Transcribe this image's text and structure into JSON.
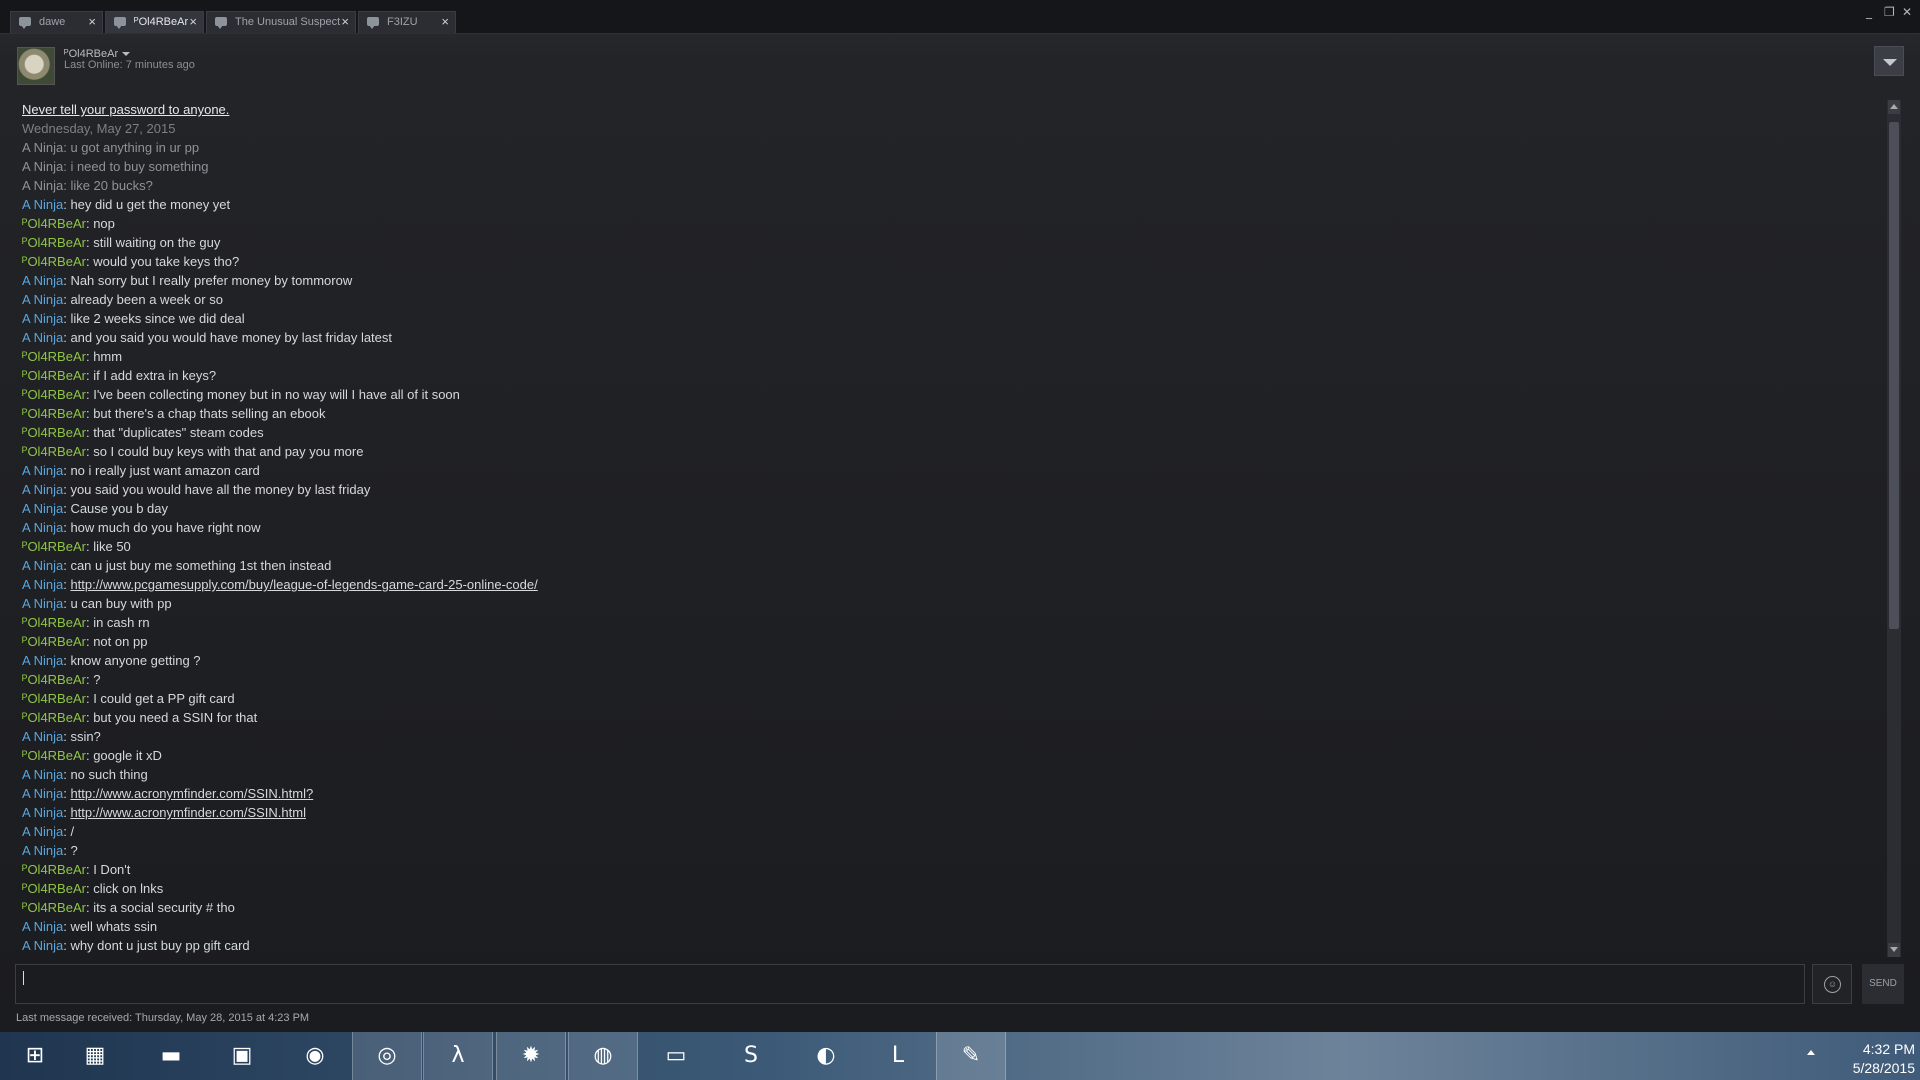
{
  "tabs": [
    {
      "label": "dawe",
      "active": false
    },
    {
      "label": "ᴾOl4RBeAr",
      "active": true
    },
    {
      "label": "The Unusual Suspect",
      "active": false
    },
    {
      "label": "F3IZU",
      "active": false
    }
  ],
  "window_controls": {
    "minimize": "_",
    "restore": "❐",
    "close": "✕"
  },
  "header": {
    "name": "ᴾOl4RBeAr",
    "status": "Last Online: 7 minutes ago"
  },
  "chat": {
    "system_warning": "Never tell your password to anyone.",
    "date": "Wednesday, May 27, 2015",
    "messages": [
      {
        "who": "A Ninja",
        "text": "u got anything in ur pp",
        "old": true
      },
      {
        "who": "A Ninja",
        "text": "i need to buy something",
        "old": true
      },
      {
        "who": "A Ninja",
        "text": "like 20 bucks?",
        "old": true
      },
      {
        "who": "A Ninja",
        "text": "hey did u get the money yet"
      },
      {
        "who": "ᴾOl4RBeAr",
        "text": "nop"
      },
      {
        "who": "ᴾOl4RBeAr",
        "text": "still waiting on the guy"
      },
      {
        "who": "ᴾOl4RBeAr",
        "text": "would you take keys tho?"
      },
      {
        "who": "A Ninja",
        "text": "Nah sorry but I really prefer money by tommorow"
      },
      {
        "who": "A Ninja",
        "text": "already been a week or so"
      },
      {
        "who": "A Ninja",
        "text": "like 2 weeks since we did deal"
      },
      {
        "who": "A Ninja",
        "text": "and you said you would have money by last friday latest"
      },
      {
        "who": "ᴾOl4RBeAr",
        "text": "hmm"
      },
      {
        "who": "ᴾOl4RBeAr",
        "text": "if I add extra in keys?"
      },
      {
        "who": "ᴾOl4RBeAr",
        "text": "I've been collecting money but in no way will I have all of it soon"
      },
      {
        "who": "ᴾOl4RBeAr",
        "text": "but there's a chap thats selling an ebook"
      },
      {
        "who": "ᴾOl4RBeAr",
        "text": "that \"duplicates\" steam codes"
      },
      {
        "who": "ᴾOl4RBeAr",
        "text": "so I could buy keys with that and pay you more"
      },
      {
        "who": "A Ninja",
        "text": "no i really just want amazon card"
      },
      {
        "who": "A Ninja",
        "text": "you said you would have all the money by last friday"
      },
      {
        "who": "A Ninja",
        "text": "Cause you b day"
      },
      {
        "who": "A Ninja",
        "text": "how much do you have right now"
      },
      {
        "who": "ᴾOl4RBeAr",
        "text": "like 50"
      },
      {
        "who": "A Ninja",
        "text": "can u just buy me something 1st then instead"
      },
      {
        "who": "A Ninja",
        "text": "http://www.pcgamesupply.com/buy/league-of-legends-game-card-25-online-code/",
        "link": true
      },
      {
        "who": "A Ninja",
        "text": "u can buy with pp"
      },
      {
        "who": "ᴾOl4RBeAr",
        "text": "in cash rn"
      },
      {
        "who": "ᴾOl4RBeAr",
        "text": "not on pp"
      },
      {
        "who": "A Ninja",
        "text": "know anyone getting ?"
      },
      {
        "who": "ᴾOl4RBeAr",
        "text": "?"
      },
      {
        "who": "ᴾOl4RBeAr",
        "text": "I could get a PP gift card"
      },
      {
        "who": "ᴾOl4RBeAr",
        "text": "but you need a SSIN for that"
      },
      {
        "who": "A Ninja",
        "text": "ssin?"
      },
      {
        "who": "ᴾOl4RBeAr",
        "text": "google it xD"
      },
      {
        "who": "A Ninja",
        "text": "no such thing"
      },
      {
        "who": "A Ninja",
        "text": "http://www.acronymfinder.com/SSIN.html?",
        "link": true
      },
      {
        "who": "A Ninja",
        "text": "http://www.acronymfinder.com/SSIN.html",
        "link": true
      },
      {
        "who": "A Ninja",
        "text": "/"
      },
      {
        "who": "A Ninja",
        "text": "?"
      },
      {
        "who": "ᴾOl4RBeAr",
        "text": "I Don't"
      },
      {
        "who": "ᴾOl4RBeAr",
        "text": "click on lnks"
      },
      {
        "who": "ᴾOl4RBeAr",
        "text": "its a social security # tho"
      },
      {
        "who": "A Ninja",
        "text": "well whats ssin"
      },
      {
        "who": "A Ninja",
        "text": "why dont u just buy pp gift card"
      }
    ]
  },
  "input": {
    "value": "",
    "send_label": "SEND",
    "emoji_glyph": "☺"
  },
  "status_bar": "Last message received: Thursday, May 28, 2015 at 4:23 PM",
  "taskbar": {
    "items": [
      {
        "name": "start-button-icon",
        "glyph": "⊞",
        "open": false
      },
      {
        "name": "calculator-icon",
        "glyph": "▦",
        "open": false
      },
      {
        "name": "file-explorer-icon",
        "glyph": "▬",
        "open": false
      },
      {
        "name": "store-icon",
        "glyph": "▣",
        "open": false
      },
      {
        "name": "orange-app-icon",
        "glyph": "◉",
        "open": false
      },
      {
        "name": "chrome-icon",
        "glyph": "◎",
        "open": true
      },
      {
        "name": "half-life-icon",
        "glyph": "λ",
        "open": true
      },
      {
        "name": "steelseries-icon",
        "glyph": "✹",
        "open": true
      },
      {
        "name": "steam-icon",
        "glyph": "◍",
        "open": true
      },
      {
        "name": "monitor-app-icon",
        "glyph": "▭",
        "open": false
      },
      {
        "name": "skype-icon",
        "glyph": "S",
        "open": false
      },
      {
        "name": "firefox-icon",
        "glyph": "◐",
        "open": false
      },
      {
        "name": "league-of-legends-icon",
        "glyph": "L",
        "open": false
      },
      {
        "name": "paint-icon",
        "glyph": "✎",
        "open": true
      }
    ],
    "time": "4:32 PM",
    "date": "5/28/2015"
  }
}
